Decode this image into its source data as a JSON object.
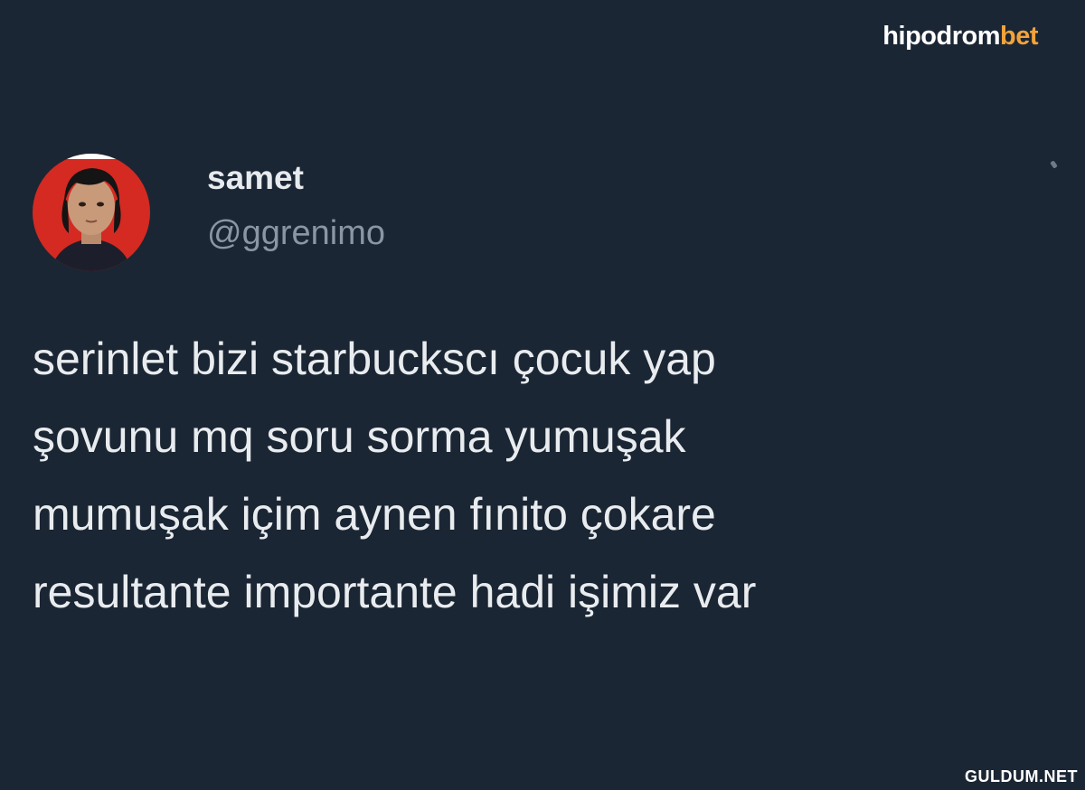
{
  "brand": {
    "logo_main": "hipodrom",
    "logo_accent": "bet",
    "accent_color": "#f2a33a"
  },
  "tweet": {
    "display_name": "samet",
    "username": "@ggrenimo",
    "text_lines": [
      "serinlet bizi starbuckscı çocuk yap",
      "şovunu mq soru sorma yumuşak",
      "mumuşak içim aynen fınito çokare",
      "resultante importante hadi işimiz var"
    ]
  },
  "watermark": "GULDUM.NET",
  "colors": {
    "background": "#1b2634",
    "avatar_background": "#d42a22"
  }
}
